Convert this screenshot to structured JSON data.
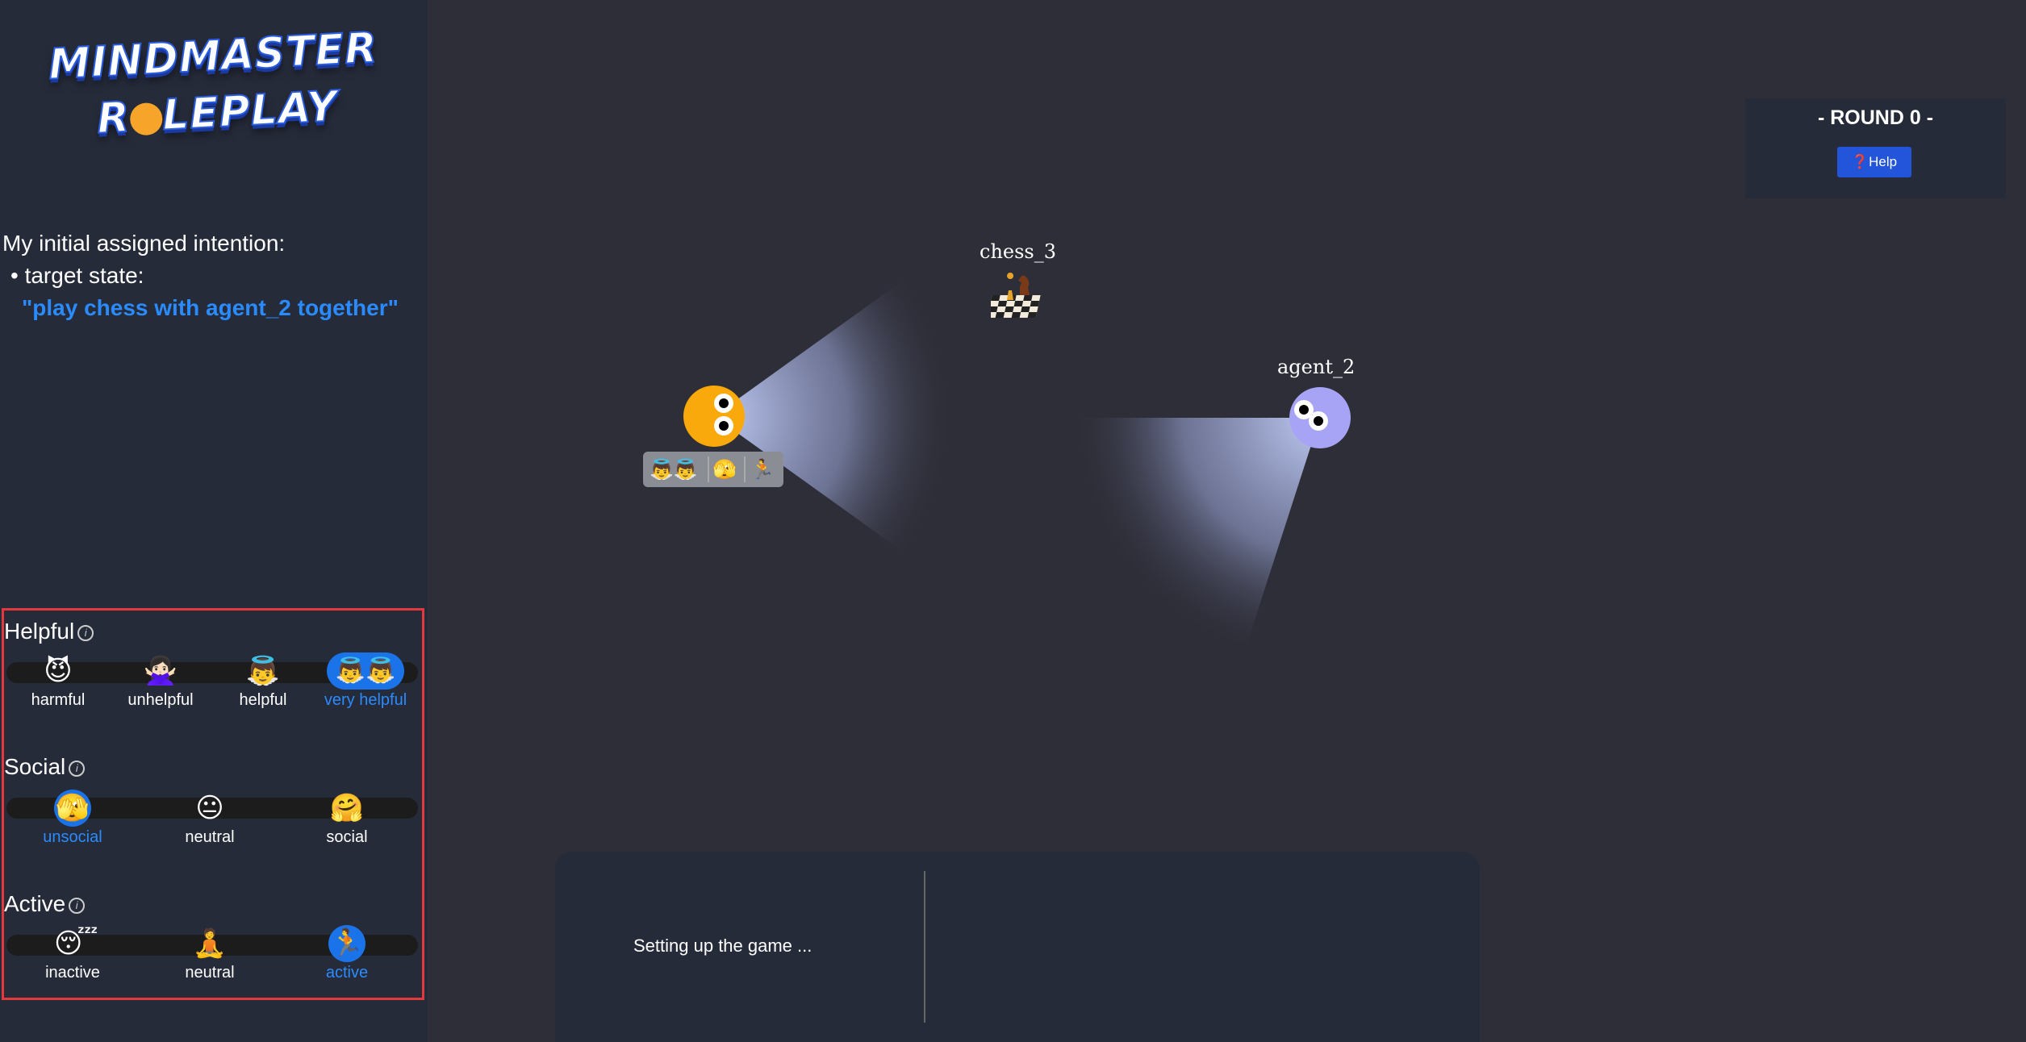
{
  "logo": {
    "line1": "MINDMASTER",
    "line2_a": "R",
    "line2_b": "LEPLAY"
  },
  "intention": {
    "heading": "My initial assigned intention:",
    "bullet": "• target state:",
    "target": "\"play chess with agent_2 together\""
  },
  "traits": {
    "helpful": {
      "title": "Helpful",
      "options": [
        {
          "icon": "😈",
          "label": "harmful",
          "selected": false
        },
        {
          "icon": "🙅🏻‍♀️",
          "label": "unhelpful",
          "selected": false
        },
        {
          "icon": "👼",
          "label": "helpful",
          "selected": false
        },
        {
          "icon": "👼👼",
          "label": "very helpful",
          "selected": true
        }
      ]
    },
    "social": {
      "title": "Social",
      "options": [
        {
          "icon": "🫣",
          "label": "unsocial",
          "selected": true
        },
        {
          "icon": "😐",
          "label": "neutral",
          "selected": false
        },
        {
          "icon": "🤗",
          "label": "social",
          "selected": false
        }
      ]
    },
    "active": {
      "title": "Active",
      "options": [
        {
          "icon": "😴",
          "label": "inactive",
          "selected": false
        },
        {
          "icon": "🧘",
          "label": "neutral",
          "selected": false
        },
        {
          "icon": "🏃",
          "label": "active",
          "selected": true
        }
      ]
    },
    "info_glyph": "i"
  },
  "round": {
    "title": "- ROUND 0 -",
    "help_icon": "❓",
    "help_label": "Help"
  },
  "scene": {
    "chess_label": "chess_3",
    "chess_icon": "♟♞",
    "agent2_label": "agent_2",
    "badge": {
      "helpful": "👼👼",
      "social": "🫣",
      "active": "🏃"
    },
    "colors": {
      "agent1": "#f9a90c",
      "agent2": "#a7a4f5",
      "cone": "#c9d4ff"
    }
  },
  "dialog": {
    "status": "Setting up the game ..."
  },
  "colors": {
    "accent": "#2a8bff",
    "highlight_border": "#e0393e",
    "button": "#2255d9"
  }
}
